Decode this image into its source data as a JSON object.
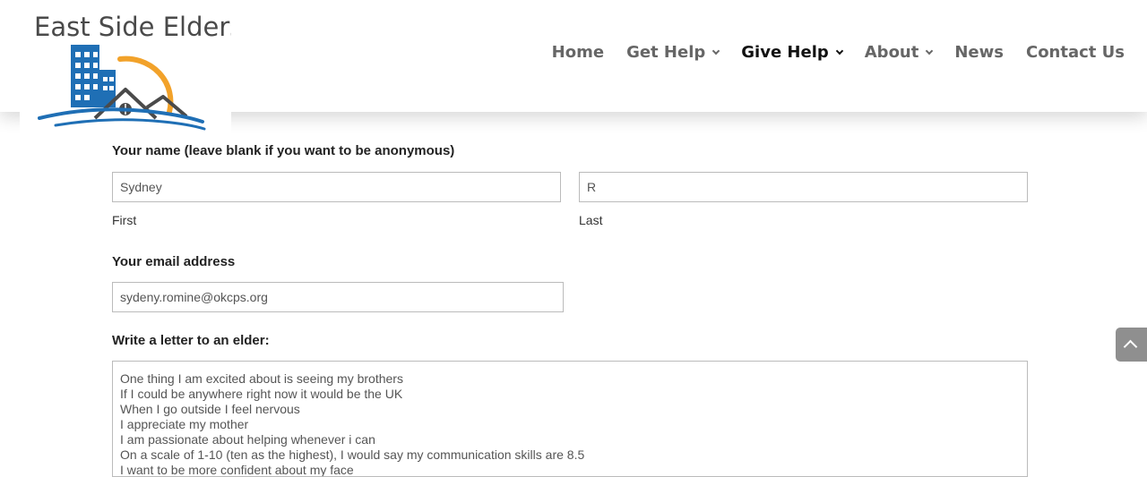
{
  "logo": {
    "text": "East Side Elders"
  },
  "nav": {
    "items": [
      {
        "label": "Home"
      },
      {
        "label": "Get Help"
      },
      {
        "label": "Give Help"
      },
      {
        "label": "About"
      },
      {
        "label": "News"
      },
      {
        "label": "Contact Us"
      }
    ]
  },
  "form": {
    "name": {
      "label": "Your name (leave blank if you want to be anonymous)",
      "first_value": "Sydney",
      "first_sublabel": "First",
      "last_value": "R",
      "last_sublabel": "Last"
    },
    "email": {
      "label": "Your email address",
      "value": "sydeny.romine@okcps.org"
    },
    "letter": {
      "label": "Write a letter to an elder:",
      "lines": [
        "",
        "One thing I am excited about is seeing my brothers",
        "If I could be anywhere right now it would be the UK",
        "When I go outside I feel nervous",
        "I appreciate my mother",
        "I am passionate about helping whenever i can",
        "On a scale of 1-10 (ten as the highest), I would say my communication skills are 8.5",
        "I want to be more confident about my face"
      ]
    }
  },
  "colors": {
    "logo_blue": "#1f6fb5",
    "logo_orange": "#f2a22a",
    "logo_dark": "#4a4a4a",
    "nav_text": "#666666",
    "nav_active": "#111111",
    "scroll_button": "#8f8f8f"
  },
  "icons": {
    "scroll_top": "chevron-up-icon",
    "dropdown": "chevron-down-icon"
  }
}
